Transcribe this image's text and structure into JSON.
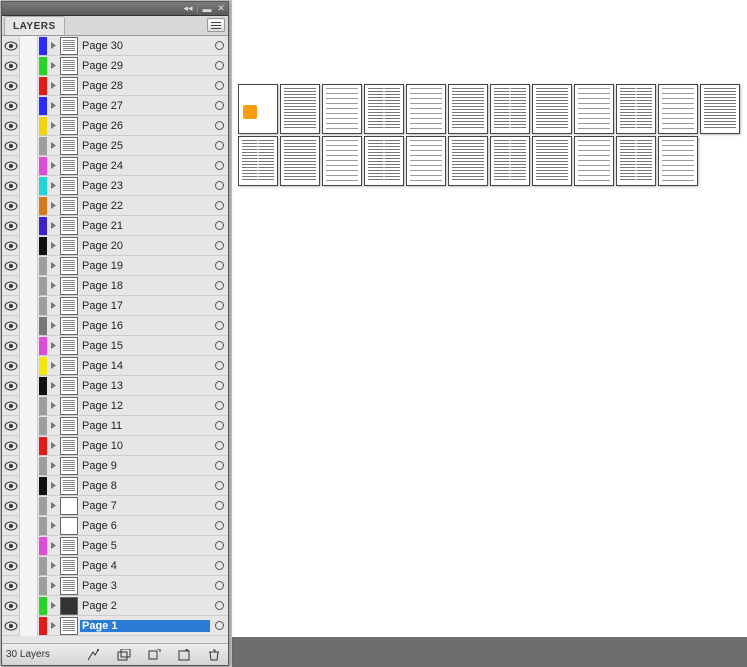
{
  "panel": {
    "title": "LAYERS",
    "count_label": "30 Layers",
    "layers": [
      {
        "name": "Page 30",
        "color": "#2b2bff",
        "selected": false
      },
      {
        "name": "Page 29",
        "color": "#28d428",
        "selected": false
      },
      {
        "name": "Page 28",
        "color": "#e11a1a",
        "selected": false
      },
      {
        "name": "Page 27",
        "color": "#2b2bff",
        "selected": false
      },
      {
        "name": "Page 26",
        "color": "#f2d40a",
        "selected": false
      },
      {
        "name": "Page 25",
        "color": "#9e9e9e",
        "selected": false
      },
      {
        "name": "Page 24",
        "color": "#e04bd8",
        "selected": false
      },
      {
        "name": "Page 23",
        "color": "#22d6d6",
        "selected": false
      },
      {
        "name": "Page 22",
        "color": "#d47a1a",
        "selected": false
      },
      {
        "name": "Page 21",
        "color": "#3a23c9",
        "selected": false
      },
      {
        "name": "Page 20",
        "color": "#111111",
        "selected": false
      },
      {
        "name": "Page 19",
        "color": "#9e9e9e",
        "selected": false
      },
      {
        "name": "Page 18",
        "color": "#9e9e9e",
        "selected": false
      },
      {
        "name": "Page 17",
        "color": "#9e9e9e",
        "selected": false
      },
      {
        "name": "Page 16",
        "color": "#777777",
        "selected": false
      },
      {
        "name": "Page 15",
        "color": "#e04bd8",
        "selected": false
      },
      {
        "name": "Page 14",
        "color": "#f2e70a",
        "selected": false
      },
      {
        "name": "Page 13",
        "color": "#111111",
        "selected": false
      },
      {
        "name": "Page 12",
        "color": "#9e9e9e",
        "selected": false
      },
      {
        "name": "Page 11",
        "color": "#9e9e9e",
        "selected": false
      },
      {
        "name": "Page 10",
        "color": "#e11a1a",
        "selected": false
      },
      {
        "name": "Page 9",
        "color": "#9e9e9e",
        "selected": false
      },
      {
        "name": "Page 8",
        "color": "#111111",
        "selected": false
      },
      {
        "name": "Page 7",
        "color": "#9e9e9e",
        "selected": false
      },
      {
        "name": "Page 6",
        "color": "#9e9e9e",
        "selected": false
      },
      {
        "name": "Page 5",
        "color": "#e04bd8",
        "selected": false
      },
      {
        "name": "Page 4",
        "color": "#9e9e9e",
        "selected": false
      },
      {
        "name": "Page 3",
        "color": "#9e9e9e",
        "selected": false
      },
      {
        "name": "Page 2",
        "color": "#28d428",
        "selected": false
      },
      {
        "name": "Page 1",
        "color": "#e11a1a",
        "selected": true
      }
    ]
  },
  "canvas": {
    "page_count": 23
  }
}
